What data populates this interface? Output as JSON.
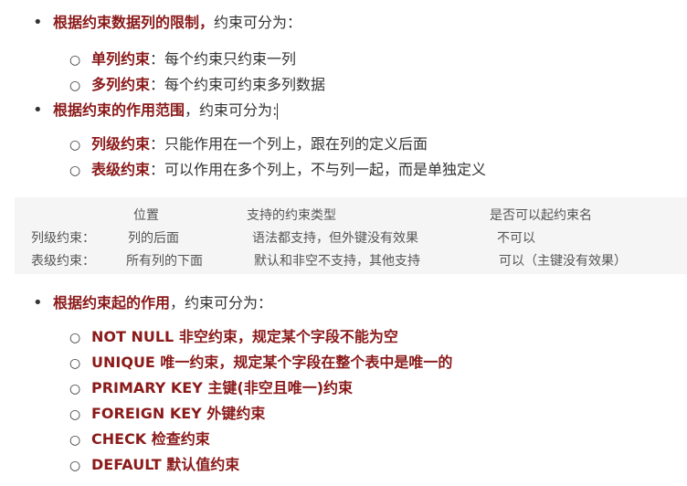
{
  "section1": {
    "lead": "根据约束数据列的限制，",
    "rest": "约束可分为：",
    "items": [
      {
        "term": "单列约束",
        "sep": "：",
        "desc": "每个约束只约束一列"
      },
      {
        "term": "多列约束",
        "sep": "：",
        "desc": "每个约束可约束多列数据"
      }
    ]
  },
  "section2": {
    "lead": "根据约束的作用范围",
    "rest": "，约束可分为:",
    "items": [
      {
        "term": "列级约束",
        "sep": "：",
        "desc": "只能作用在一个列上，跟在列的定义后面"
      },
      {
        "term": "表级约束",
        "sep": "：",
        "desc": "可以作用在多个列上，不与列一起，而是单独定义"
      }
    ]
  },
  "table": {
    "headers": [
      "位置",
      "支持的约束类型",
      "是否可以起约束名"
    ],
    "rows": [
      {
        "label": "列级约束：",
        "cells": [
          "列的后面",
          "语法都支持，但外键没有效果",
          "不可以"
        ]
      },
      {
        "label": "表级约束：",
        "cells": [
          "所有列的下面",
          "默认和非空不支持，其他支持",
          "可以（主键没有效果）"
        ]
      }
    ]
  },
  "section3": {
    "lead": "根据约束起的作用",
    "rest": "，约束可分为：",
    "items": [
      "NOT NULL 非空约束，规定某个字段不能为空",
      "UNIQUE 唯一约束，规定某个字段在整个表中是唯一的",
      "PRIMARY KEY 主键(非空且唯一)约束",
      "FOREIGN KEY 外键约束",
      "CHECK 检查约束",
      "DEFAULT 默认值约束"
    ]
  },
  "icons": {
    "disc": "•",
    "circle": "○"
  },
  "colors": {
    "emphasis": "#8b1a1a",
    "text": "#333333",
    "code_bg": "#f5f5f5"
  }
}
